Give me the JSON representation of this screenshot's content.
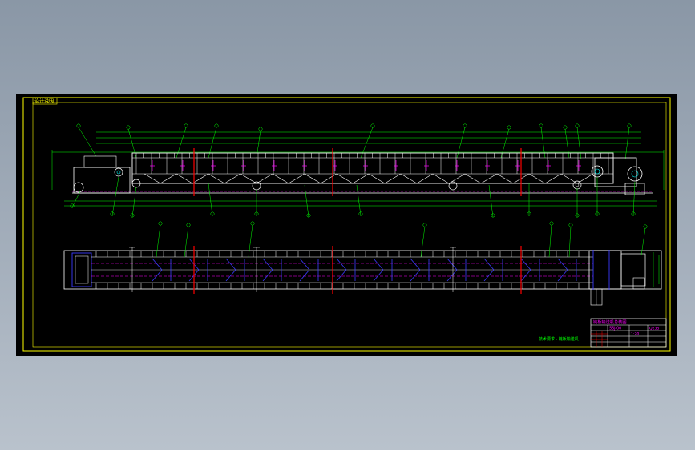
{
  "drawing": {
    "corner_tag": "设计说明",
    "note_text": "技术要求 · 链板输送机",
    "title_block": {
      "drawing_title": "链板输送机总装图",
      "drawing_code": "SSJ-00",
      "material": "Q235",
      "scale": "1:20"
    },
    "colors": {
      "background": "#000000",
      "frame": "#ffff00",
      "outline": "#ffffff",
      "dimension": "#00ff00",
      "hidden": "#ff00ff",
      "center": "#ff0000",
      "detail": "#00ffff",
      "frame_blue": "#3b3bff"
    }
  }
}
